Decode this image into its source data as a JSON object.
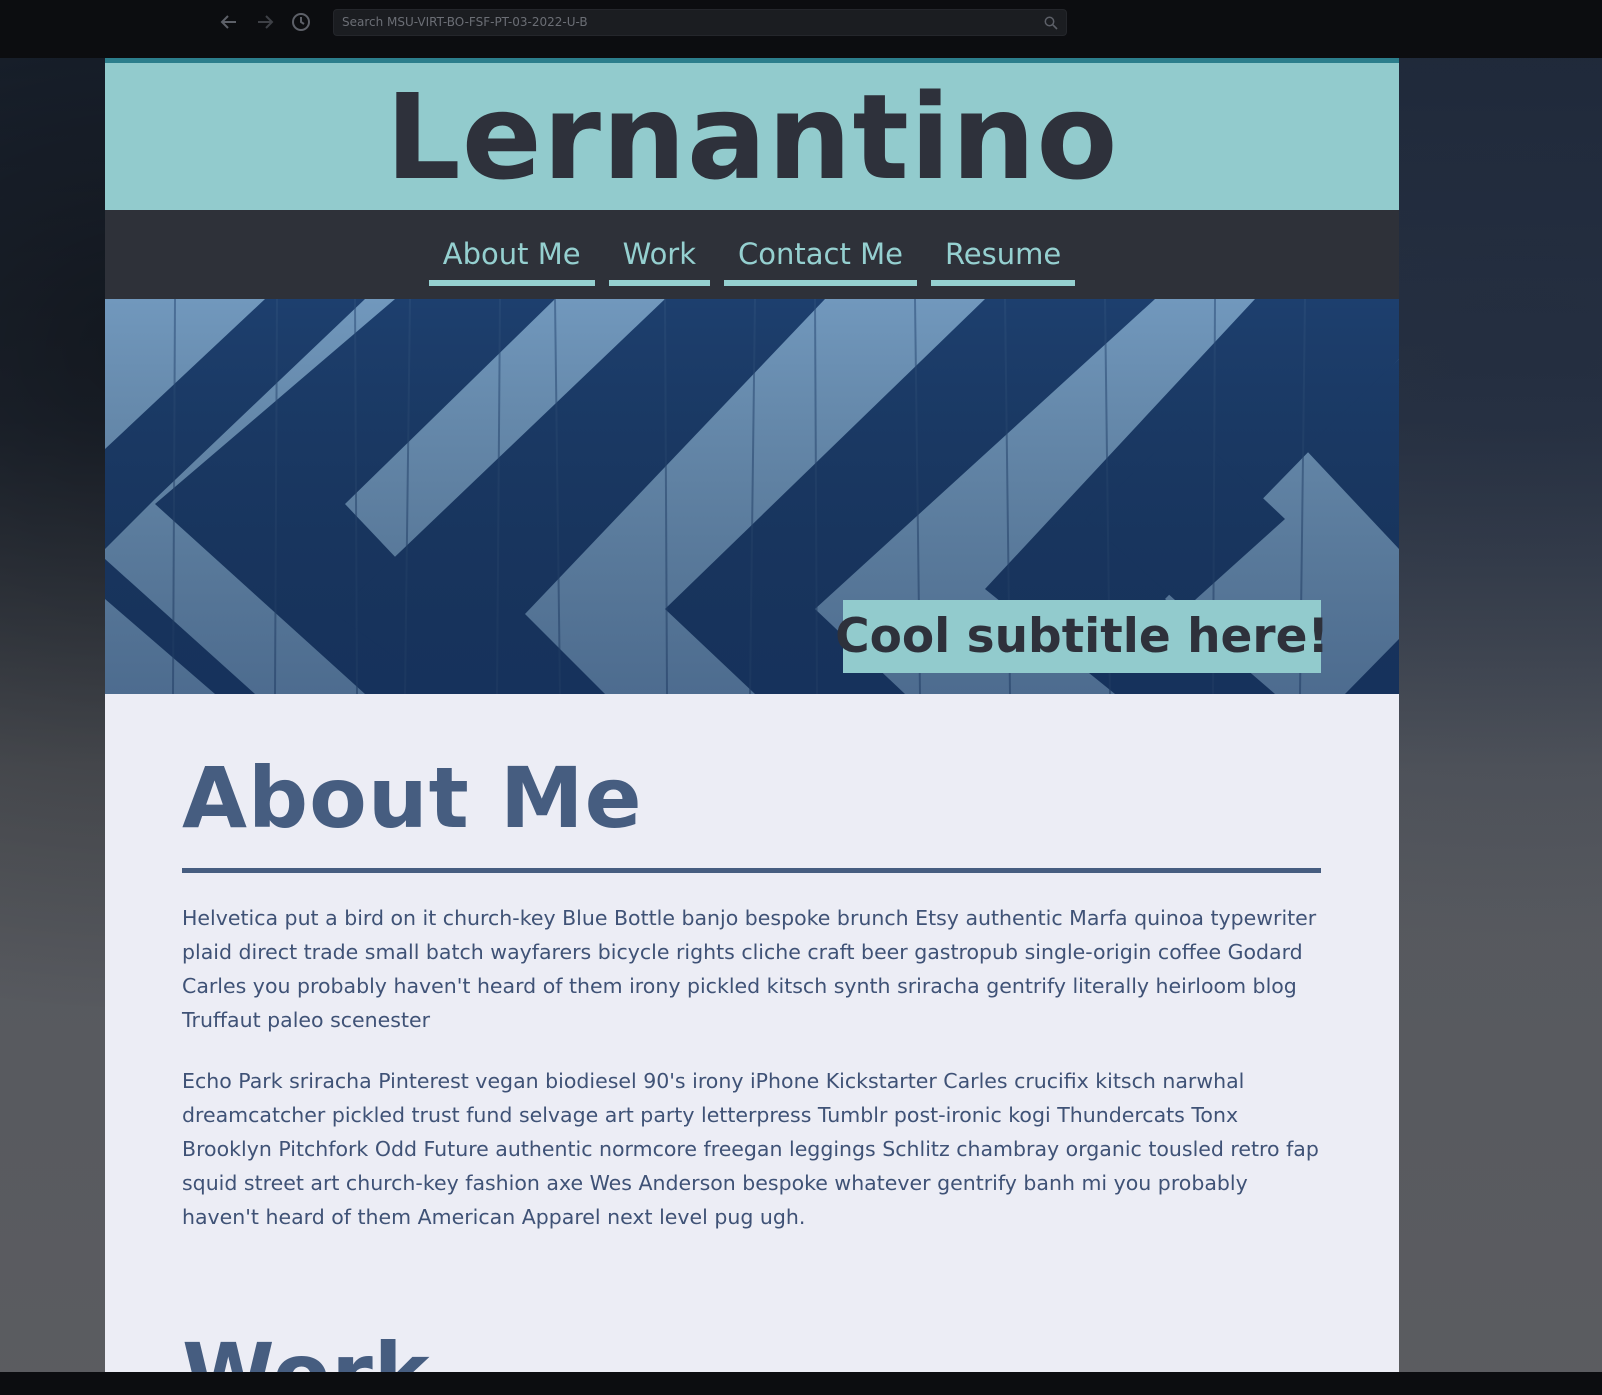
{
  "browser": {
    "search_placeholder": "Search MSU-VIRT-BO-FSF-PT-03-2022-U-B",
    "back_icon": "arrow-left-icon",
    "forward_icon": "arrow-right-icon",
    "history_icon": "clock-icon",
    "search_icon": "search-icon"
  },
  "site": {
    "title": "Lernantino"
  },
  "nav": {
    "items": [
      {
        "label": "About Me"
      },
      {
        "label": "Work"
      },
      {
        "label": "Contact Me"
      },
      {
        "label": "Resume"
      }
    ]
  },
  "hero": {
    "subtitle": "Cool subtitle here!"
  },
  "about": {
    "title": "About Me",
    "paragraphs": [
      "Helvetica put a bird on it church-key Blue Bottle banjo bespoke brunch Etsy authentic Marfa quinoa typewriter plaid direct trade small batch wayfarers bicycle rights cliche craft beer gastropub single-origin coffee Godard Carles you probably haven't heard of them irony pickled kitsch synth sriracha gentrify literally heirloom blog Truffaut paleo scenester",
      "Echo Park sriracha Pinterest vegan biodiesel 90's irony iPhone Kickstarter Carles crucifix kitsch narwhal dreamcatcher pickled trust fund selvage art party letterpress Tumblr post-ironic kogi Thundercats Tonx Brooklyn Pitchfork Odd Future authentic normcore freegan leggings Schlitz chambray organic tousled retro fap squid street art church-key fashion axe Wes Anderson bespoke whatever gentrify banh mi you probably haven't heard of them American Apparel next level pug ugh."
    ]
  },
  "work": {
    "title": "Work"
  },
  "colors": {
    "header_bg": "#92cbcd",
    "nav_bg": "#2e3139",
    "nav_link": "#95d0d0",
    "heading": "#465d80",
    "body_text": "#3f5276",
    "page_bg": "#ecedf5"
  }
}
